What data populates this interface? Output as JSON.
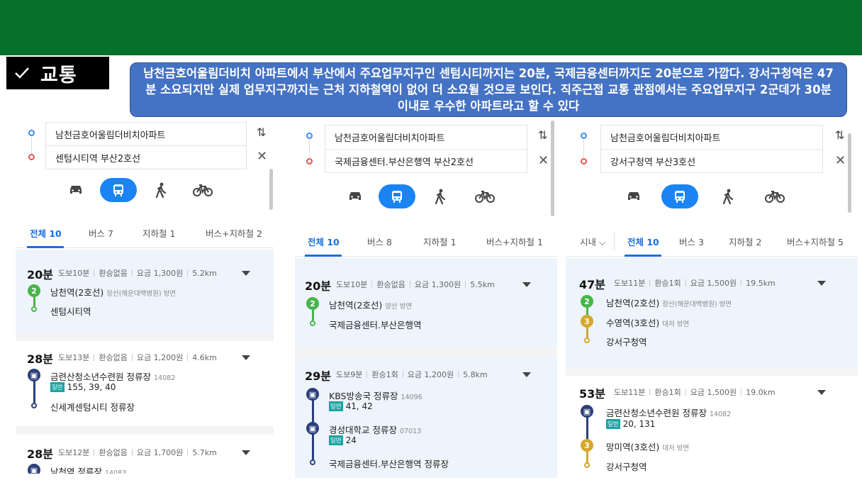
{
  "header": {
    "section_tag": "교통",
    "summary": "남천금호어울림더비치 아파트에서 부산에서 주요업무지구인 센텀시티까지는 20분, 국제금융센터까지도 20분으로 가깝다. 강서구청역은 47분 소요되지만 실제 업무지구까지는 근처 지하철역이 없어 더 소요될 것으로 보인다. 직주근접 교통 관점에서는 주요업무지구 2군데가 30분이내로 우수한 아파트라고 할 수 있다"
  },
  "panels": [
    {
      "origin": "남천금호어울림더비치아파트",
      "destination": "센텀시티역 부산2호선",
      "tabs": [
        "전체 10",
        "버스 7",
        "지하철 1",
        "버스+지하철 2"
      ],
      "routes": [
        {
          "duration": "20분",
          "meta": [
            "도보10분",
            "환승없음",
            "요금 1,300원",
            "5.2km"
          ],
          "s1": "남천역(2호선)",
          "s1_dir": "장산(해운대백병원) 방면",
          "s2": "센텀시티역"
        },
        {
          "duration": "28분",
          "meta": [
            "도보13분",
            "환승없음",
            "요금 1,200원",
            "4.6km"
          ],
          "s1": "금련산청소년수련원 정류장",
          "s1_dir": "14082",
          "badge": "일반",
          "bus": "155, 39, 40",
          "s2": "신세계센텀시티 정류장"
        },
        {
          "duration": "28분",
          "meta": [
            "도보12분",
            "환승없음",
            "요금 1,700원",
            "5.7km"
          ],
          "s1": "남천역 정류장",
          "s1_dir": "14083"
        }
      ]
    },
    {
      "origin": "남천금호어울림더비치아파트",
      "destination": "국제금융센터.부산은행역 부산2호선",
      "tabs": [
        "전체 10",
        "버스 8",
        "지하철 1",
        "버스+지하철 1"
      ],
      "routes": [
        {
          "duration": "20분",
          "meta": [
            "도보10분",
            "환승없음",
            "요금 1,300원",
            "5.5km"
          ],
          "s1": "남천역(2호선)",
          "s1_dir": "양산 방면",
          "s2": "국제금융센터.부산은행역"
        },
        {
          "duration": "29분",
          "meta": [
            "도보9분",
            "환승1회",
            "요금 1,200원",
            "5.8km"
          ],
          "s1": "KBS방송국 정류장",
          "s1_dir": "14096",
          "badge1": "일반",
          "bus1": "41, 42",
          "s2": "경성대학교 정류장",
          "s2_dir": "07013",
          "badge2": "일반",
          "bus2": "24",
          "s3": "국제금융센터.부산은행역 정류장"
        }
      ]
    },
    {
      "origin": "남천금호어울림더비치아파트",
      "destination": "강서구청역 부산3호선",
      "tabs": [
        "시내 ⌵",
        "전체 10",
        "버스 3",
        "지하철 2",
        "버스+지하철 5"
      ],
      "routes": [
        {
          "duration": "47분",
          "meta": [
            "도보11분",
            "환승1회",
            "요금 1,500원",
            "19.5km"
          ],
          "s1": "남천역(2호선)",
          "s1_dir": "장산(해운대백병원) 방면",
          "s2": "수영역(3호선)",
          "s2_dir": "대저 방면",
          "s3": "강서구청역"
        },
        {
          "duration": "53분",
          "meta": [
            "도보11분",
            "환승1회",
            "요금 1,500원",
            "19.0km"
          ],
          "s1": "금련산청소년수련원 정류장",
          "s1_dir": "14082",
          "badge": "일반",
          "bus": "20, 131",
          "s2": "망미역(3호선)",
          "s2_dir": "대저 방면",
          "s3": "강서구청역"
        }
      ]
    }
  ],
  "line_badges": {
    "line2": "2",
    "line3": "3"
  },
  "colors": {
    "header_green": "#07702b",
    "summary_blue": "#4472c4",
    "accent": "#1a84f5",
    "line2": "#48b54a",
    "line3": "#d4a82d",
    "bus": "#2b3f7a"
  }
}
